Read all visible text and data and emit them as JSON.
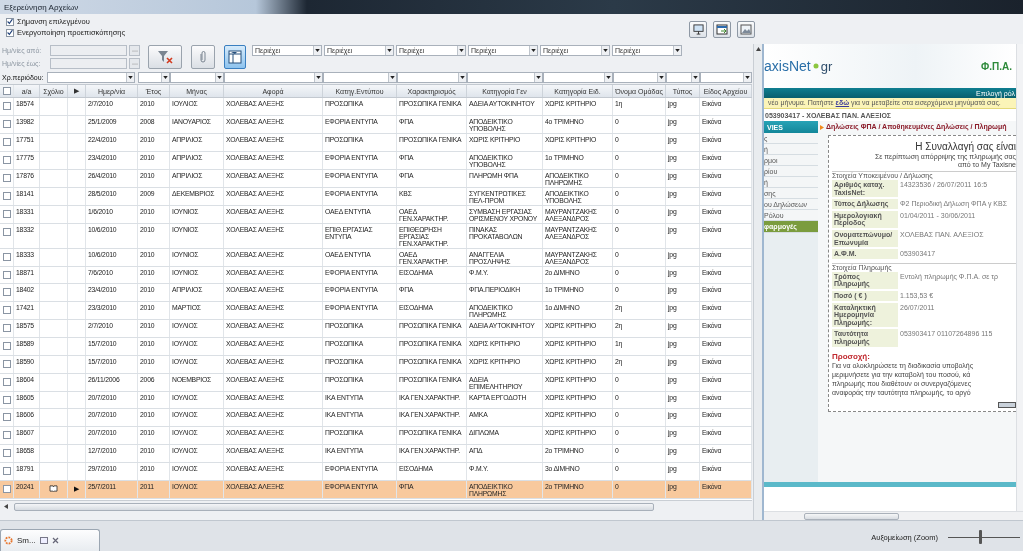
{
  "window": {
    "title": "Εξερεύνηση Αρχείων"
  },
  "options": [
    {
      "label": "Σήμανση επιλεγμένου",
      "checked": true
    },
    {
      "label": "Ενεργοποίηση προεπισκόπησης",
      "checked": true
    }
  ],
  "date_filters": [
    {
      "label": "Ημ/νίες από:",
      "disabled": true
    },
    {
      "label": "Ημ/νίες έως:",
      "disabled": true
    }
  ],
  "tool_buttons": [
    {
      "kind": "clear-filter",
      "on": false
    },
    {
      "kind": "attach",
      "on": false
    },
    {
      "kind": "filter",
      "on": true
    }
  ],
  "text_filters": [
    "Περιέχει",
    "Περιέχει",
    "Περιέχει",
    "Περιέχει",
    "Περιέχει",
    "Περιέχει"
  ],
  "period_label": "Χρ.περιόδου:",
  "table": {
    "header_checked": false,
    "columns": [
      "a/a",
      "Σχόλιο",
      "▶",
      "Ημερ/νία",
      "Έτος",
      "Μήνας",
      "Αφορά",
      "Κατηγ.Εντύπου",
      "Χαρακτηρισμός",
      "Κατηγορία Γεν",
      "Κατηγορία Ειδ.",
      "Όνομα Ομάδας",
      "Τύπος",
      "Είδος Αρχείου"
    ],
    "rows": [
      {
        "checked": false,
        "selected": false,
        "comment": false,
        "current": false,
        "cells": [
          "18574",
          "",
          "",
          "2/7/2010",
          "2010",
          "ΙΟΥΛΙΟΣ",
          "ΧΟΛΕΒΑΣ ΑΛΕΞΗΣ",
          "ΠΡΟΣΩΠΙΚΑ",
          "ΠΡΟΣΩΠΙΚΑ ΓΕΝΙΚΑ",
          "ΑΔΕΙΑ ΑΥΤΟΚΙΝΗΤΟΥ",
          "ΧΩΡΙΣ ΚΡΙΤΗΡΙΟ",
          "1η",
          "jpg",
          "Εικόνα"
        ]
      },
      {
        "checked": false,
        "selected": false,
        "comment": false,
        "current": false,
        "cells": [
          "13982",
          "",
          "",
          "25/1/2009",
          "2008",
          "ΙΑΝΟΥΑΡΙΟΣ",
          "ΧΟΛΕΒΑΣ ΑΛΕΞΗΣ",
          "ΕΦΟΡΙΑ ΕΝΤΥΠΑ",
          "ΦΠΑ",
          "ΑΠΟΔΕΙΚΤΙΚΟ ΥΠΟΒΟΛΗΣ",
          "4ο ΤΡΙΜΗΝΟ",
          "0",
          "jpg",
          "Εικόνα"
        ]
      },
      {
        "checked": false,
        "selected": false,
        "comment": false,
        "current": false,
        "cells": [
          "17751",
          "",
          "",
          "22/4/2010",
          "2010",
          "ΑΠΡΙΛΙΟΣ",
          "ΧΟΛΕΒΑΣ ΑΛΕΞΗΣ",
          "ΠΡΟΣΩΠΙΚΑ",
          "ΠΡΟΣΩΠΙΚΑ ΓΕΝΙΚΑ",
          "ΧΩΡΙΣ ΚΡΙΤΗΡΙΟ",
          "ΧΩΡΙΣ ΚΡΙΤΗΡΙΟ",
          "0",
          "jpg",
          "Εικόνα"
        ]
      },
      {
        "checked": false,
        "selected": false,
        "comment": false,
        "current": false,
        "cells": [
          "17775",
          "",
          "",
          "23/4/2010",
          "2010",
          "ΑΠΡΙΛΙΟΣ",
          "ΧΟΛΕΒΑΣ ΑΛΕΞΗΣ",
          "ΕΦΟΡΙΑ ΕΝΤΥΠΑ",
          "ΦΠΑ",
          "ΑΠΟΔΕΙΚΤΙΚΟ ΥΠΟΒΟΛΗΣ",
          "1ο ΤΡΙΜΗΝΟ",
          "0",
          "jpg",
          "Εικόνα"
        ]
      },
      {
        "checked": false,
        "selected": false,
        "comment": false,
        "current": false,
        "cells": [
          "17876",
          "",
          "",
          "26/4/2010",
          "2010",
          "ΑΠΡΙΛΙΟΣ",
          "ΧΟΛΕΒΑΣ ΑΛΕΞΗΣ",
          "ΕΦΟΡΙΑ ΕΝΤΥΠΑ",
          "ΦΠΑ",
          "ΠΛΗΡΩΜΗ ΦΠΑ",
          "ΑΠΟΔΕΙΚΤΙΚΟ ΠΛΗΡΩΜΗΣ",
          "0",
          "jpg",
          "Εικόνα"
        ]
      },
      {
        "checked": false,
        "selected": false,
        "comment": false,
        "current": false,
        "cells": [
          "18141",
          "",
          "",
          "28/5/2010",
          "2009",
          "ΔΕΚΕΜΒΡΙΟΣ",
          "ΧΟΛΕΒΑΣ ΑΛΕΞΗΣ",
          "ΕΦΟΡΙΑ ΕΝΤΥΠΑ",
          "ΚΒΣ",
          "ΣΥΓΚΕΝΤΡΩΤΙΚΕΣ ΠΕΛ-ΠΡΟΜ",
          "ΑΠΟΔΕΙΚΤΙΚΟ ΥΠΟΒΟΛΗΣ",
          "0",
          "jpg",
          "Εικόνα"
        ]
      },
      {
        "checked": false,
        "selected": false,
        "comment": false,
        "current": false,
        "cells": [
          "18331",
          "",
          "",
          "1/6/2010",
          "2010",
          "ΙΟΥΝΙΟΣ",
          "ΧΟΛΕΒΑΣ ΑΛΕΞΗΣ",
          "ΟΑΕΔ ΕΝΤΥΠΑ",
          "ΟΑΕΔ ΓΕΝ.ΧΑΡΑΚΤΗΡ.",
          "ΣΥΜΒΑΣΗ ΕΡΓΑΣΙΑΣ ΟΡΙΣΜΕΝΟΥ ΧΡΟΝΟΥ",
          "ΜΑΥΡΑΝΤΖΑΚΗΣ ΑΛΕΞΑΝΔΡΟΣ",
          "0",
          "jpg",
          "Εικόνα"
        ]
      },
      {
        "checked": false,
        "selected": false,
        "comment": false,
        "current": false,
        "cells": [
          "18332",
          "",
          "",
          "10/6/2010",
          "2010",
          "ΙΟΥΝΙΟΣ",
          "ΧΟΛΕΒΑΣ ΑΛΕΞΗΣ",
          "ΕΠΙΘ.ΕΡΓΑΣΙΑΣ ΕΝΤΥΠΑ",
          "ΕΠΙΘΕΩΡΗΣΗ ΕΡΓΑΣΙΑΣ ΓΕΝ.ΧΑΡΑΚΤΗΡ.",
          "ΠΙΝΑΚΑΣ ΠΡΟΚΑΤΑΒΟΛΩΝ",
          "ΜΑΥΡΑΝΤΖΑΚΗΣ ΑΛΕΞΑΝΔΡΟΣ",
          "0",
          "jpg",
          "Εικόνα"
        ]
      },
      {
        "checked": false,
        "selected": false,
        "comment": false,
        "current": false,
        "cells": [
          "18333",
          "",
          "",
          "10/6/2010",
          "2010",
          "ΙΟΥΝΙΟΣ",
          "ΧΟΛΕΒΑΣ ΑΛΕΞΗΣ",
          "ΟΑΕΔ ΕΝΤΥΠΑ",
          "ΟΑΕΔ ΓΕΝ.ΧΑΡΑΚΤΗΡ.",
          "ΑΝΑΓΓΕΛΙΑ ΠΡΟΣΛΗΨΗΣ",
          "ΜΑΥΡΑΝΤΖΑΚΗΣ ΑΛΕΞΑΝΔΡΟΣ",
          "0",
          "jpg",
          "Εικόνα"
        ]
      },
      {
        "checked": false,
        "selected": false,
        "comment": false,
        "current": false,
        "cells": [
          "18871",
          "",
          "",
          "7/6/2010",
          "2010",
          "ΙΟΥΝΙΟΣ",
          "ΧΟΛΕΒΑΣ ΑΛΕΞΗΣ",
          "ΕΦΟΡΙΑ ΕΝΤΥΠΑ",
          "ΕΙΣΟΔΗΜΑ",
          "Φ.Μ.Υ.",
          "2ο ΔΙΜΗΝΟ",
          "0",
          "jpg",
          "Εικόνα"
        ]
      },
      {
        "checked": false,
        "selected": false,
        "comment": false,
        "current": false,
        "cells": [
          "18402",
          "",
          "",
          "23/4/2010",
          "2010",
          "ΑΠΡΙΛΙΟΣ",
          "ΧΟΛΕΒΑΣ ΑΛΕΞΗΣ",
          "ΕΦΟΡΙΑ ΕΝΤΥΠΑ",
          "ΦΠΑ",
          "ΦΠΑ.ΠΕΡΙΟΔΙΚΗ",
          "1ο ΤΡΙΜΗΝΟ",
          "0",
          "jpg",
          "Εικόνα"
        ]
      },
      {
        "checked": false,
        "selected": false,
        "comment": false,
        "current": false,
        "cells": [
          "17421",
          "",
          "",
          "23/3/2010",
          "2010",
          "ΜΑΡΤΙΟΣ",
          "ΧΟΛΕΒΑΣ ΑΛΕΞΗΣ",
          "ΕΦΟΡΙΑ ΕΝΤΥΠΑ",
          "ΕΙΣΟΔΗΜΑ",
          "ΑΠΟΔΕΙΚΤΙΚΟ ΠΛΗΡΩΜΗΣ",
          "1ο ΔΙΜΗΝΟ",
          "2η",
          "jpg",
          "Εικόνα"
        ]
      },
      {
        "checked": false,
        "selected": false,
        "comment": false,
        "current": false,
        "cells": [
          "18575",
          "",
          "",
          "2/7/2010",
          "2010",
          "ΙΟΥΛΙΟΣ",
          "ΧΟΛΕΒΑΣ ΑΛΕΞΗΣ",
          "ΠΡΟΣΩΠΙΚΑ",
          "ΠΡΟΣΩΠΙΚΑ ΓΕΝΙΚΑ",
          "ΑΔΕΙΑ ΑΥΤΟΚΙΝΗΤΟΥ",
          "ΧΩΡΙΣ ΚΡΙΤΗΡΙΟ",
          "2η",
          "jpg",
          "Εικόνα"
        ]
      },
      {
        "checked": false,
        "selected": false,
        "comment": false,
        "current": false,
        "cells": [
          "18589",
          "",
          "",
          "15/7/2010",
          "2010",
          "ΙΟΥΛΙΟΣ",
          "ΧΟΛΕΒΑΣ ΑΛΕΞΗΣ",
          "ΠΡΟΣΩΠΙΚΑ",
          "ΠΡΟΣΩΠΙΚΑ ΓΕΝΙΚΑ",
          "ΧΩΡΙΣ ΚΡΙΤΗΡΙΟ",
          "ΧΩΡΙΣ ΚΡΙΤΗΡΙΟ",
          "1η",
          "jpg",
          "Εικόνα"
        ]
      },
      {
        "checked": false,
        "selected": false,
        "comment": false,
        "current": false,
        "cells": [
          "18590",
          "",
          "",
          "15/7/2010",
          "2010",
          "ΙΟΥΛΙΟΣ",
          "ΧΟΛΕΒΑΣ ΑΛΕΞΗΣ",
          "ΠΡΟΣΩΠΙΚΑ",
          "ΠΡΟΣΩΠΙΚΑ ΓΕΝΙΚΑ",
          "ΧΩΡΙΣ ΚΡΙΤΗΡΙΟ",
          "ΧΩΡΙΣ ΚΡΙΤΗΡΙΟ",
          "2η",
          "jpg",
          "Εικόνα"
        ]
      },
      {
        "checked": false,
        "selected": false,
        "comment": false,
        "current": false,
        "cells": [
          "18604",
          "",
          "",
          "26/11/2006",
          "2006",
          "ΝΟΕΜΒΡΙΟΣ",
          "ΧΟΛΕΒΑΣ ΑΛΕΞΗΣ",
          "ΠΡΟΣΩΠΙΚΑ",
          "ΠΡΟΣΩΠΙΚΑ ΓΕΝΙΚΑ",
          "ΑΔΕΙΑ ΕΠΙΜΕΛΗΤΗΡΙΟΥ",
          "ΧΩΡΙΣ ΚΡΙΤΗΡΙΟ",
          "0",
          "jpg",
          "Εικόνα"
        ]
      },
      {
        "checked": false,
        "selected": false,
        "comment": false,
        "current": false,
        "cells": [
          "18605",
          "",
          "",
          "20/7/2010",
          "2010",
          "ΙΟΥΛΙΟΣ",
          "ΧΟΛΕΒΑΣ ΑΛΕΞΗΣ",
          "ΙΚΑ ΕΝΤΥΠΑ",
          "ΙΚΑ ΓΕΝ.ΧΑΡΑΚΤΗΡ.",
          "ΚΑΡΤΑ ΕΡΓΟΔΟΤΗ",
          "ΧΩΡΙΣ ΚΡΙΤΗΡΙΟ",
          "0",
          "jpg",
          "Εικόνα"
        ]
      },
      {
        "checked": false,
        "selected": false,
        "comment": false,
        "current": false,
        "cells": [
          "18606",
          "",
          "",
          "20/7/2010",
          "2010",
          "ΙΟΥΛΙΟΣ",
          "ΧΟΛΕΒΑΣ ΑΛΕΞΗΣ",
          "ΙΚΑ ΕΝΤΥΠΑ",
          "ΙΚΑ ΓΕΝ.ΧΑΡΑΚΤΗΡ.",
          "ΑΜΚΑ",
          "ΧΩΡΙΣ ΚΡΙΤΗΡΙΟ",
          "0",
          "jpg",
          "Εικόνα"
        ]
      },
      {
        "checked": false,
        "selected": false,
        "comment": false,
        "current": false,
        "cells": [
          "18607",
          "",
          "",
          "20/7/2010",
          "2010",
          "ΙΟΥΛΙΟΣ",
          "ΧΟΛΕΒΑΣ ΑΛΕΞΗΣ",
          "ΠΡΟΣΩΠΙΚΑ",
          "ΠΡΟΣΩΠΙΚΑ ΓΕΝΙΚΑ",
          "ΔΙΠΛΩΜΑ",
          "ΧΩΡΙΣ ΚΡΙΤΗΡΙΟ",
          "0",
          "jpg",
          "Εικόνα"
        ]
      },
      {
        "checked": false,
        "selected": false,
        "comment": false,
        "current": false,
        "cells": [
          "18658",
          "",
          "",
          "12/7/2010",
          "2010",
          "ΙΟΥΛΙΟΣ",
          "ΧΟΛΕΒΑΣ ΑΛΕΞΗΣ",
          "ΙΚΑ ΕΝΤΥΠΑ",
          "ΙΚΑ ΓΕΝ.ΧΑΡΑΚΤΗΡ.",
          "ΑΠΔ",
          "2ο ΤΡΙΜΗΝΟ",
          "0",
          "jpg",
          "Εικόνα"
        ]
      },
      {
        "checked": false,
        "selected": false,
        "comment": false,
        "current": false,
        "cells": [
          "18791",
          "",
          "",
          "29/7/2010",
          "2010",
          "ΙΟΥΛΙΟΣ",
          "ΧΟΛΕΒΑΣ ΑΛΕΞΗΣ",
          "ΕΦΟΡΙΑ ΕΝΤΥΠΑ",
          "ΕΙΣΟΔΗΜΑ",
          "Φ.Μ.Υ.",
          "3ο ΔΙΜΗΝΟ",
          "0",
          "jpg",
          "Εικόνα"
        ]
      },
      {
        "checked": false,
        "selected": true,
        "comment": true,
        "current": true,
        "cells": [
          "20241",
          "",
          "▶",
          "25/7/2011",
          "2011",
          "ΙΟΥΛΙΟΣ",
          "ΧΟΛΕΒΑΣ ΑΛΕΞΗΣ",
          "ΕΦΟΡΙΑ ΕΝΤΥΠΑ",
          "ΦΠΑ",
          "ΑΠΟΔΕΙΚΤΙΚΟ ΠΛΗΡΩΜΗΣ",
          "2ο ΤΡΙΜΗΝΟ",
          "0",
          "jpg",
          "Εικόνα"
        ]
      }
    ]
  },
  "preview": {
    "logo_main": "axisNet",
    "logo_suffix": "gr",
    "heading": "Φ.Π.Α.",
    "role_bar": "Επιλογή ρόλ",
    "notice": {
      "before": "νέο μήνυμα. Πατήστε",
      "link": "εδώ",
      "after": "για να μεταβείτε στα εισερχόμενα μηνύματά σας."
    },
    "user_line": "053903417 - ΧΟΛΕΒΑΣ ΠΑΝ. ΑΛΕΞΙΟΣ",
    "nav_title": "VIES",
    "nav_items": [
      {
        "label": "ς",
        "kind": "link"
      },
      {
        "label": "ή",
        "kind": "link"
      },
      {
        "label": "ρμοι",
        "kind": "link"
      },
      {
        "label": "ρίου",
        "kind": "link"
      },
      {
        "label": "ή",
        "kind": "link"
      },
      {
        "label": "σης",
        "kind": "link"
      },
      {
        "label": "ου Δηλώσεων",
        "kind": "link"
      },
      {
        "label": "Ρόλου",
        "kind": "link"
      },
      {
        "label": "φαρμογές",
        "kind": "section"
      }
    ],
    "breadcrumb": "Δηλώσεις ΦΠΑ / Αποθηκευμένες Δηλώσεις / Πληρωμή",
    "title": "Η Συναλλαγή σας είναι",
    "subtitle": [
      "Σε περίπτωση απόρριψης της πληρωμής σας",
      "από το My Taxisne"
    ],
    "sections": [
      {
        "legend": "Στοιχεία Υποκειμένου / Δήλωσης",
        "fields": [
          {
            "label": "Αριθμός καταχ. TaxisNet:",
            "value": "14323536 / 26/07/2011 16:5"
          },
          {
            "label": "Τύπος Δήλωσης",
            "value": "Φ2 Περιοδική Δήλωση ΦΠΑ γ ΚΒΣ"
          },
          {
            "label": "Ημερολογιακή Περίοδος",
            "value": "01/04/2011 - 30/06/2011"
          },
          {
            "label": "Ονοματεπώνυμο/ Επωνυμία",
            "value": "ΧΟΛΕΒΑΣ ΠΑΝ. ΑΛΕΞΙΟΣ"
          },
          {
            "label": "Α.Φ.Μ.",
            "value": "053903417"
          }
        ]
      },
      {
        "legend": "Στοιχεία Πληρωμής",
        "fields": [
          {
            "label": "Τρόπος Πληρωμής",
            "value": "Εντολή πληρωμής Φ.Π.Α. σε τρ"
          },
          {
            "label": "Ποσό ( € )",
            "value": "1.153,53 €"
          },
          {
            "label": "Καταληκτική Ημερομηνία Πληρωμής:",
            "value": "26/07/2011"
          },
          {
            "label": "Ταυτότητα πληρωμής",
            "value": "053903417 01107264896 115"
          }
        ]
      }
    ],
    "warning_title": "Προσοχή:",
    "warning_lines": [
      "Για να ολοκληρώσετε τη διαδικασία υποβολής",
      "μεριμνήσετε για την καταβολή του ποσού, κά",
      "πληρωμής που διαθέτουν οι συνεργαζόμενες",
      "αναφοράς την ταυτότητα πληρωμής, το αργό"
    ]
  },
  "taskbar": {
    "tab": "Sm..."
  },
  "zoom": {
    "label": "Αυξομείωση (Zoom)",
    "level": 0.45
  }
}
